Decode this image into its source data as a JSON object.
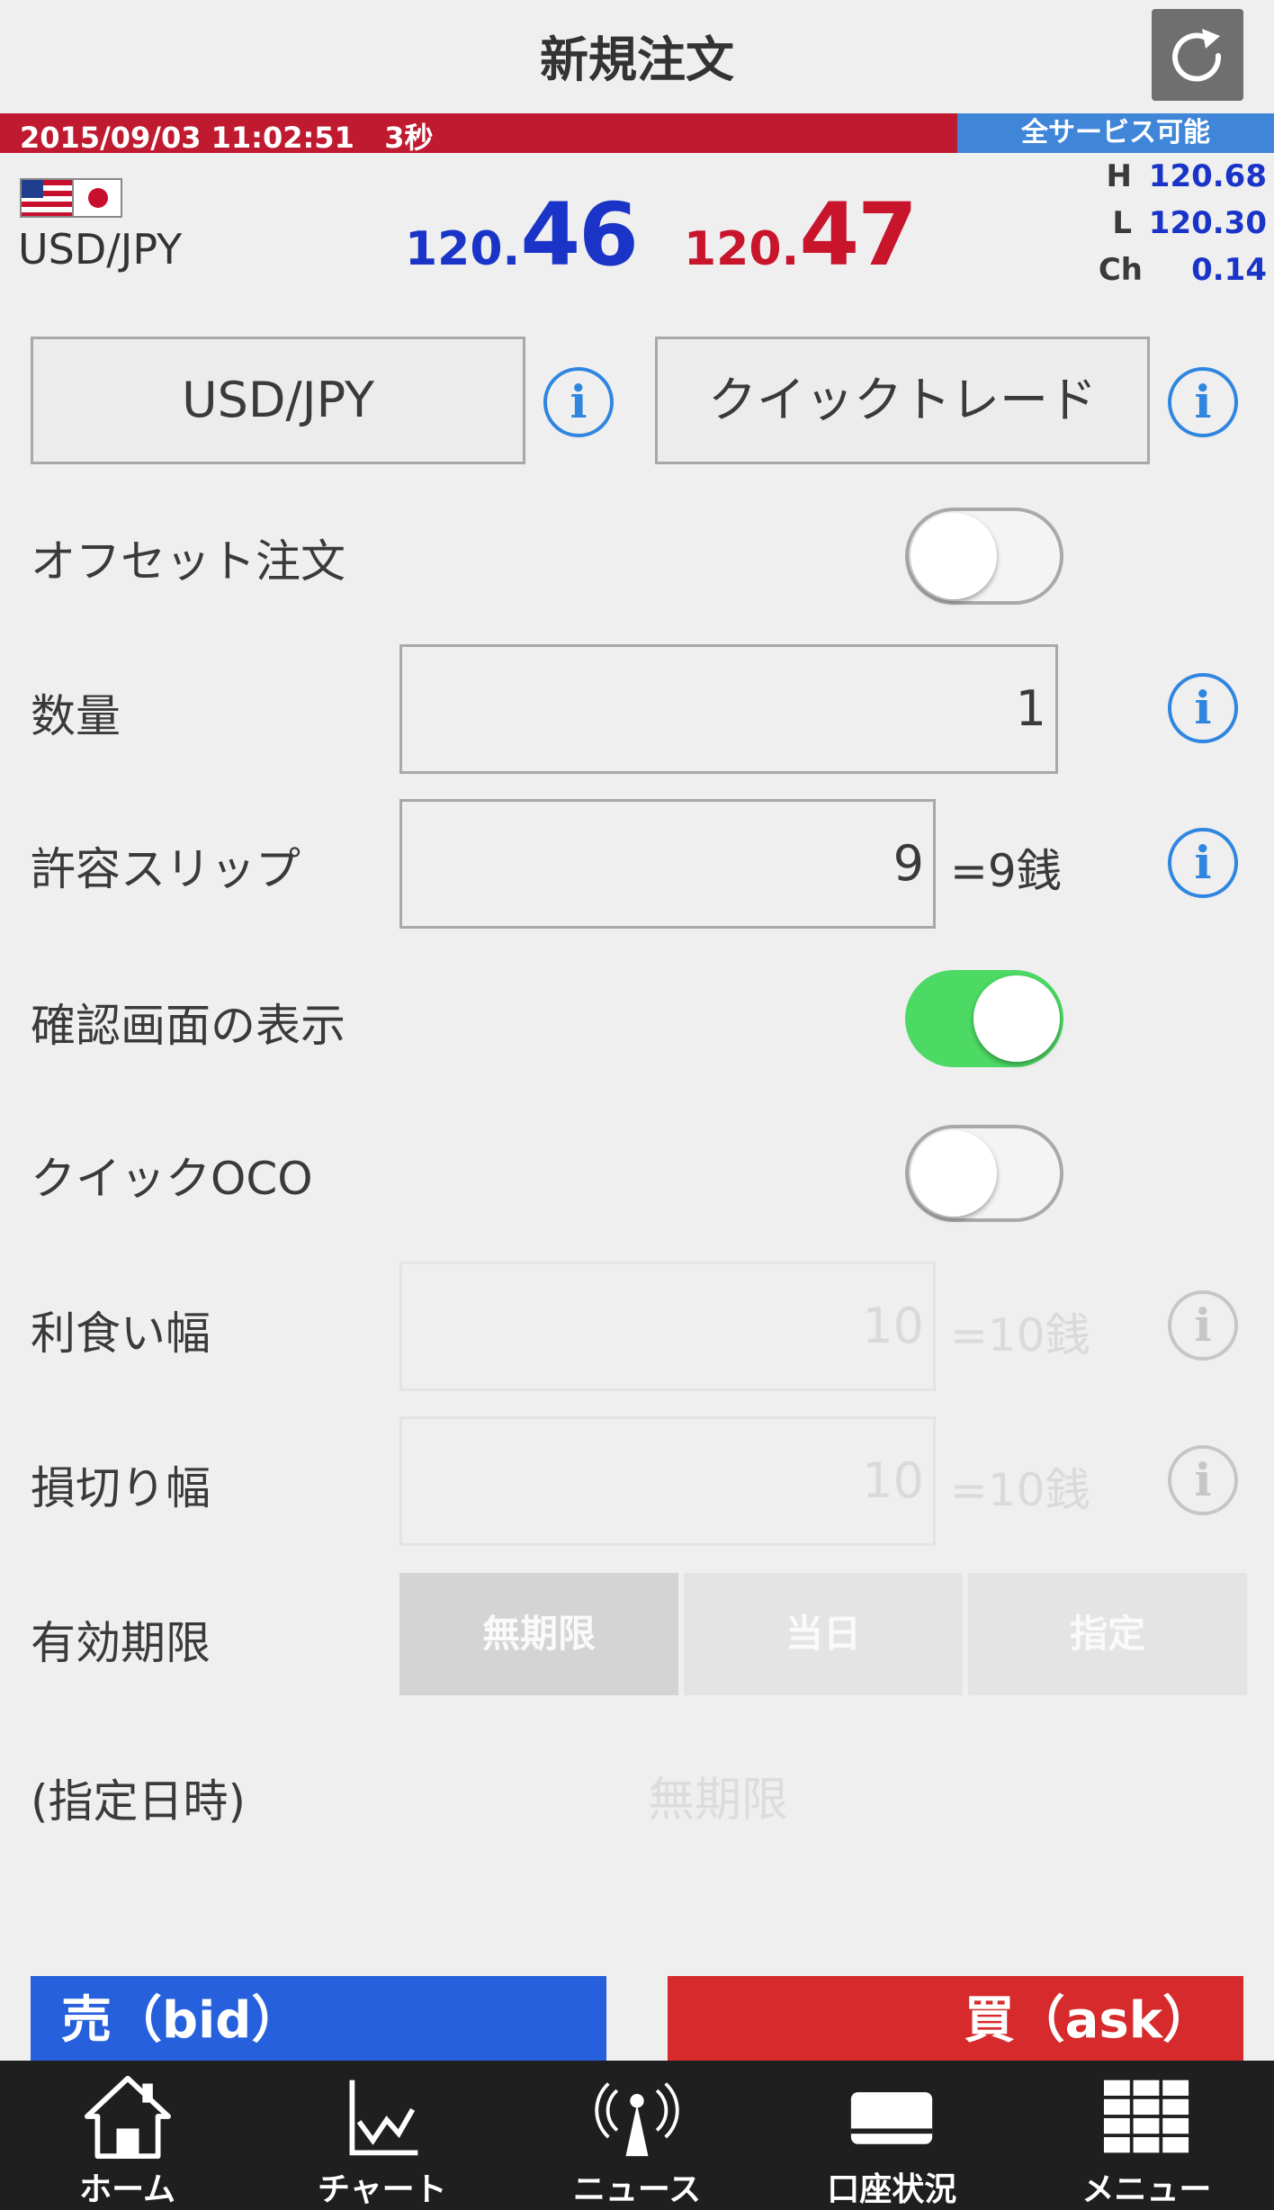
{
  "header": {
    "title": "新規注文"
  },
  "status": {
    "time": "2015/09/03 11:02:51",
    "delay": "3秒",
    "service": "全サービス可能"
  },
  "rate": {
    "pair": "USD/JPY",
    "bid_prefix": "120.",
    "bid_main": "46",
    "ask_prefix": "120.",
    "ask_main": "47",
    "high_label": "H",
    "high": "120.68",
    "low_label": "L",
    "low": "120.30",
    "change_label": "Ch",
    "change": "0.14"
  },
  "selectors": {
    "pair": "USD/JPY",
    "order_type": "クイックトレード"
  },
  "form": {
    "offset_label": "オフセット注文",
    "offset_on": false,
    "quantity_label": "数量",
    "quantity": "1",
    "slip_label": "許容スリップ",
    "slip": "9",
    "slip_suffix": "=9銭",
    "confirm_label": "確認画面の表示",
    "confirm_on": true,
    "quick_oco_label": "クイックOCO",
    "quick_oco_on": false,
    "take_profit_label": "利食い幅",
    "take_profit": "10",
    "take_profit_suffix": "=10銭",
    "stop_loss_label": "損切り幅",
    "stop_loss": "10",
    "stop_loss_suffix": "=10銭",
    "expiry_label": "有効期限",
    "expiry_options": [
      "無期限",
      "当日",
      "指定"
    ],
    "expiry_selected": "無期限",
    "datetime_label": "(指定日時)",
    "datetime_value": "無期限"
  },
  "actions": {
    "sell": "売（bid）",
    "buy": "買（ask）"
  },
  "tabs": [
    "ホーム",
    "チャート",
    "ニュース",
    "口座状況",
    "メニュー"
  ],
  "colors": {
    "bid": "#1a34c8",
    "ask": "#c8152c",
    "status_bar": "#c01a30",
    "toggle_on": "#4cd964",
    "info": "#2f86e0"
  },
  "icons": [
    "refresh-icon",
    "us-flag-icon",
    "jp-flag-icon",
    "info-icon",
    "home-icon",
    "chart-icon",
    "news-icon",
    "account-icon",
    "menu-icon"
  ]
}
